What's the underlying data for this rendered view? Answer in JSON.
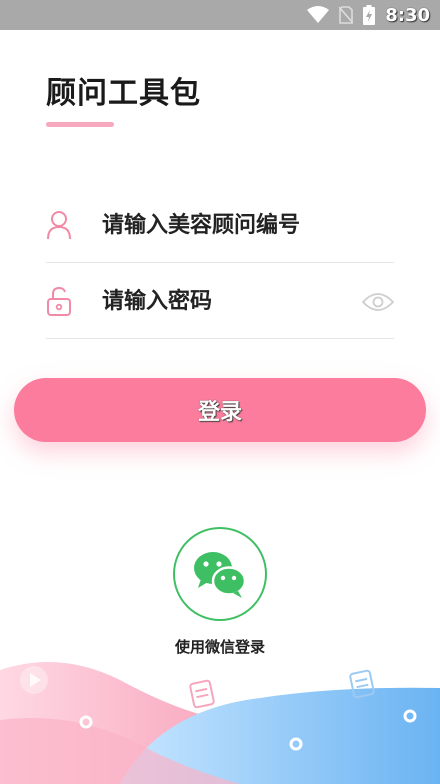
{
  "status_bar": {
    "time": "8:30"
  },
  "title": "顾问工具包",
  "form": {
    "consultant_placeholder": "请输入美容顾问编号",
    "password_placeholder": "请输入密码"
  },
  "login_label": "登录",
  "wechat_label": "使用微信登录",
  "colors": {
    "accent": "#fb7c9c",
    "underline": "#f6a8bf",
    "wechat_green": "#3fbf63",
    "status_bar": "#a9a9a9"
  },
  "icons": [
    "wifi-icon",
    "no-sim-icon",
    "battery-icon",
    "user-icon",
    "lock-icon",
    "eye-icon",
    "wechat-icon",
    "note-icon"
  ]
}
